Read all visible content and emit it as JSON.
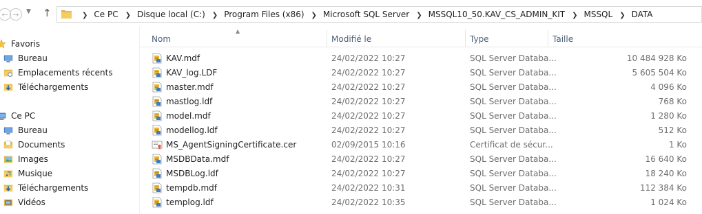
{
  "address": {
    "crumbs": [
      "Ce PC",
      "Disque local (C:)",
      "Program Files (x86)",
      "Microsoft SQL Server",
      "MSSQL10_50.KAV_CS_ADMIN_KIT",
      "MSSQL",
      "DATA"
    ]
  },
  "sidebar": {
    "favorites": {
      "label": "Favoris",
      "items": [
        "Bureau",
        "Emplacements récents",
        "Téléchargements"
      ]
    },
    "this_pc": {
      "label": "Ce PC",
      "items": [
        "Bureau",
        "Documents",
        "Images",
        "Musique",
        "Téléchargements",
        "Vidéos"
      ]
    }
  },
  "columns": {
    "name": "Nom",
    "modified": "Modifié le",
    "type": "Type",
    "size": "Taille"
  },
  "files": [
    {
      "name": "KAV.mdf",
      "modified": "24/02/2022 10:27",
      "type": "SQL Server Databa...",
      "size": "10 484 928 Ko",
      "icon": "sql-database-file-icon"
    },
    {
      "name": "KAV_log.LDF",
      "modified": "24/02/2022 10:27",
      "type": "SQL Server Databa...",
      "size": "5 605 504 Ko",
      "icon": "sql-database-file-icon"
    },
    {
      "name": "master.mdf",
      "modified": "24/02/2022 10:27",
      "type": "SQL Server Databa...",
      "size": "4 096 Ko",
      "icon": "sql-database-file-icon"
    },
    {
      "name": "mastlog.ldf",
      "modified": "24/02/2022 10:27",
      "type": "SQL Server Databa...",
      "size": "768 Ko",
      "icon": "sql-database-file-icon"
    },
    {
      "name": "model.mdf",
      "modified": "24/02/2022 10:27",
      "type": "SQL Server Databa...",
      "size": "1 280 Ko",
      "icon": "sql-database-file-icon"
    },
    {
      "name": "modellog.ldf",
      "modified": "24/02/2022 10:27",
      "type": "SQL Server Databa...",
      "size": "512 Ko",
      "icon": "sql-database-file-icon"
    },
    {
      "name": "MS_AgentSigningCertificate.cer",
      "modified": "02/09/2015 10:16",
      "type": "Certificat de sécur...",
      "size": "1 Ko",
      "icon": "certificate-file-icon"
    },
    {
      "name": "MSDBData.mdf",
      "modified": "24/02/2022 10:27",
      "type": "SQL Server Databa...",
      "size": "16 640 Ko",
      "icon": "sql-database-file-icon"
    },
    {
      "name": "MSDBLog.ldf",
      "modified": "24/02/2022 10:27",
      "type": "SQL Server Databa...",
      "size": "18 240 Ko",
      "icon": "sql-database-file-icon"
    },
    {
      "name": "tempdb.mdf",
      "modified": "24/02/2022 10:31",
      "type": "SQL Server Databa...",
      "size": "112 384 Ko",
      "icon": "sql-database-file-icon"
    },
    {
      "name": "templog.ldf",
      "modified": "24/02/2022 10:35",
      "type": "SQL Server Databa...",
      "size": "1 024 Ko",
      "icon": "sql-database-file-icon"
    }
  ]
}
